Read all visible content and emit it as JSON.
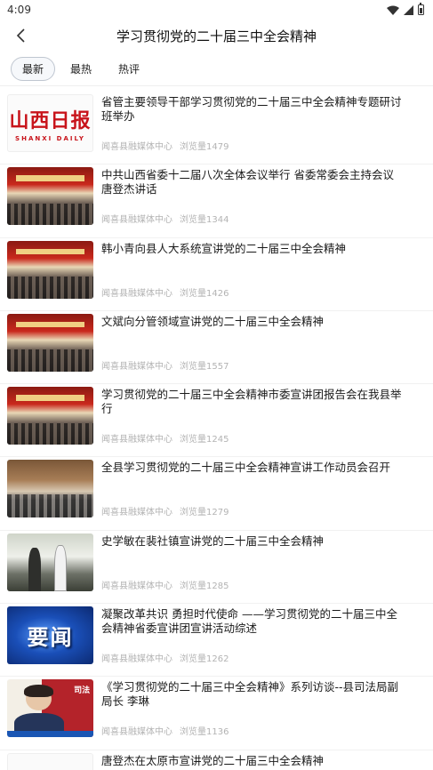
{
  "status_bar": {
    "time": "4:09"
  },
  "header": {
    "title": "学习贯彻党的二十届三中全会精神"
  },
  "tabs": [
    {
      "label": "最新",
      "active": true
    },
    {
      "label": "最热",
      "active": false
    },
    {
      "label": "热评",
      "active": false
    }
  ],
  "thumbnail_labels": {
    "logo_cn": "山西日报",
    "logo_en": "SHANXI DAILY",
    "news": "要闻",
    "portrait_sign": "司法"
  },
  "articles": [
    {
      "title": "省管主要领导干部学习贯彻党的二十届三中全会精神专题研讨班举办",
      "source": "闻喜县融媒体中心",
      "views": "浏览量1479"
    },
    {
      "title": "中共山西省委十二届八次全体会议举行 省委常委会主持会议 唐登杰讲话",
      "source": "闻喜县融媒体中心",
      "views": "浏览量1344"
    },
    {
      "title": "韩小青向县人大系统宣讲党的二十届三中全会精神",
      "source": "闻喜县融媒体中心",
      "views": "浏览量1426"
    },
    {
      "title": "文斌向分管领域宣讲党的二十届三中全会精神",
      "source": "闻喜县融媒体中心",
      "views": "浏览量1557"
    },
    {
      "title": "学习贯彻党的二十届三中全会精神市委宣讲团报告会在我县举行",
      "source": "闻喜县融媒体中心",
      "views": "浏览量1245"
    },
    {
      "title": "全县学习贯彻党的二十届三中全会精神宣讲工作动员会召开",
      "source": "闻喜县融媒体中心",
      "views": "浏览量1279"
    },
    {
      "title": "史学敏在裴社镇宣讲党的二十届三中全会精神",
      "source": "闻喜县融媒体中心",
      "views": "浏览量1285"
    },
    {
      "title": "凝聚改革共识 勇担时代使命 ——学习贯彻党的二十届三中全会精神省委宣讲团宣讲活动综述",
      "source": "闻喜县融媒体中心",
      "views": "浏览量1262"
    },
    {
      "title": "《学习贯彻党的二十届三中全会精神》系列访谈--县司法局副局长 李琳",
      "source": "闻喜县融媒体中心",
      "views": "浏览量1136"
    },
    {
      "title": "唐登杰在太原市宣讲党的二十届三中全会精神"
    }
  ]
}
